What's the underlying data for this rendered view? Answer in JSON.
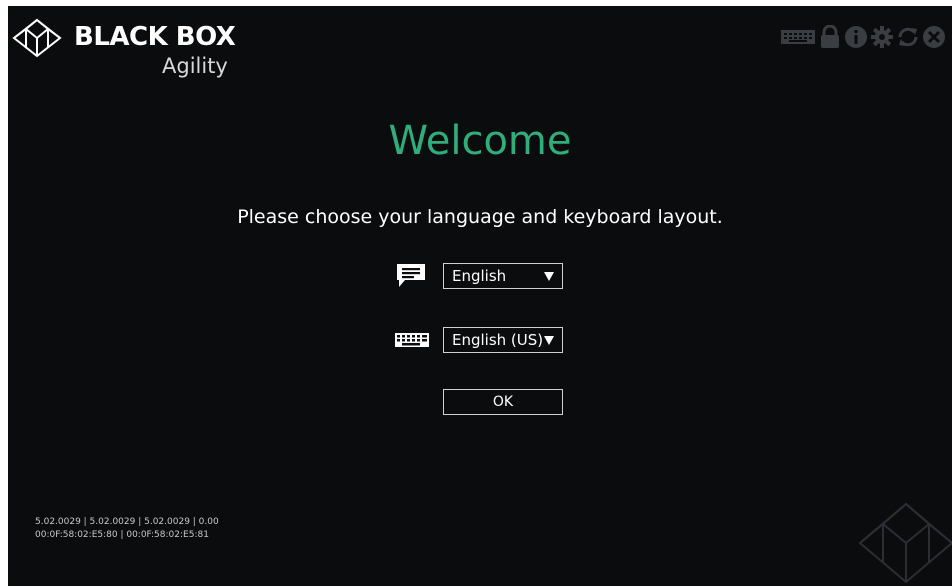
{
  "brand": {
    "name": "BLACK BOX",
    "product": "Agility"
  },
  "toolbar": {
    "icons": [
      "keyboard-icon",
      "lock-icon",
      "info-icon",
      "settings-icon",
      "refresh-icon",
      "close-icon"
    ]
  },
  "main": {
    "title": "Welcome",
    "prompt": "Please choose your language and keyboard layout.",
    "language_select": {
      "icon": "message-icon",
      "value": "English"
    },
    "keyboard_select": {
      "icon": "keyboard-icon",
      "value": "English (US)"
    },
    "ok_label": "OK"
  },
  "footer": {
    "versions": "5.02.0029 | 5.02.0029 | 5.02.0029 | 0.00",
    "mac_addresses": "00:0F:58:02:E5:80 | 00:0F:58:02:E5:81"
  },
  "colors": {
    "background": "#0b0c0e",
    "accent": "#2eae7a",
    "toolbar_icon": "#3a3d42"
  }
}
